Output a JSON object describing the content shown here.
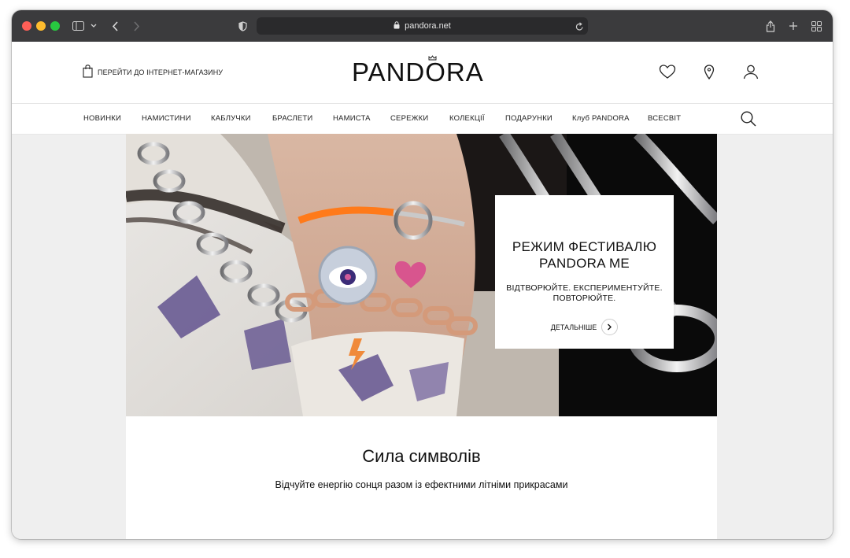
{
  "browser": {
    "url": "pandora.net",
    "colors": {
      "close": "#ff5f57",
      "minimize": "#febc2e",
      "zoom": "#28c840",
      "titlebar": "#3b3b3d"
    },
    "icons": [
      "sidebar-icon",
      "chevron-down-icon",
      "back-icon",
      "forward-icon",
      "shield-icon",
      "lock-icon",
      "reload-icon",
      "share-icon",
      "new-tab-icon",
      "tab-overview-icon"
    ]
  },
  "header": {
    "shop_link": "ПЕРЕЙТИ ДО ІНТЕРНЕТ-МАГАЗИНУ",
    "logo": "PANDORA",
    "icons": [
      "heart-icon",
      "location-pin-icon",
      "account-icon"
    ]
  },
  "nav": {
    "items": [
      "НОВИНКИ",
      "НАМИСТИНИ",
      "КАБЛУЧКИ",
      "БРАСЛЕТИ",
      "НАМИСТА",
      "СЕРЕЖКИ",
      "КОЛЕКЦІЇ",
      "ПОДАРУНКИ",
      "Клуб PANDORA",
      "ВСЕСВІТ"
    ]
  },
  "hero": {
    "title_line1": "РЕЖИМ ФЕСТИВАЛЮ",
    "title_line2": "PANDORA ME",
    "subtitle_line1": "ВІДТВОРЮЙТЕ. ЕКСПЕРИМЕНТУЙТЕ.",
    "subtitle_line2": "ПОВТОРЮЙТЕ.",
    "cta": "ДЕТАЛЬНІШЕ"
  },
  "section": {
    "title": "Сила символів",
    "subtitle": "Відчуйте енергію сонця разом із ефектними літніми прикрасами"
  }
}
